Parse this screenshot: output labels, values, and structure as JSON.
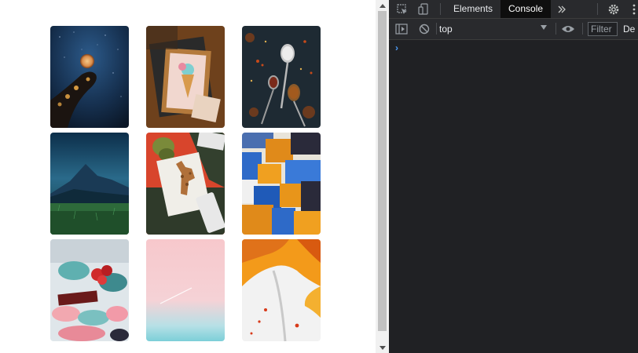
{
  "gallery": {
    "images": [
      {
        "subject": "hand holding a glowing moon under starry sky"
      },
      {
        "subject": "framed ice cream cone drawing on wooden desk"
      },
      {
        "subject": "spoons with spices on dark stone surface"
      },
      {
        "subject": "mountain landscape at night over green meadow"
      },
      {
        "subject": "giraffe sketch on paper with leaves on red background"
      },
      {
        "subject": "abstract blue and orange painted collage"
      },
      {
        "subject": "floral illustration with red roses and teal leaves"
      },
      {
        "subject": "soft pink sky with airplane contrail"
      },
      {
        "subject": "orange and white abstract ink art"
      }
    ]
  },
  "devtools": {
    "tabs": [
      {
        "label": "Elements",
        "active": false
      },
      {
        "label": "Console",
        "active": true
      }
    ],
    "context": "top",
    "filter_placeholder": "Filter",
    "levels_label": "De",
    "prompt_symbol": "›",
    "icons": [
      "inspect-element-icon",
      "device-toolbar-icon",
      "more-tabs-icon",
      "settings-gear-icon",
      "kebab-menu-icon",
      "console-sidebar-icon",
      "clear-console-icon",
      "live-expression-eye-icon"
    ]
  },
  "colors": {
    "devtools_bg": "#202124",
    "devtools_bar": "#292a2d",
    "active_tab_bg": "#0e0e0e",
    "prompt_blue": "#4d9cf8",
    "scrollbar_thumb": "#c1c1c1"
  }
}
